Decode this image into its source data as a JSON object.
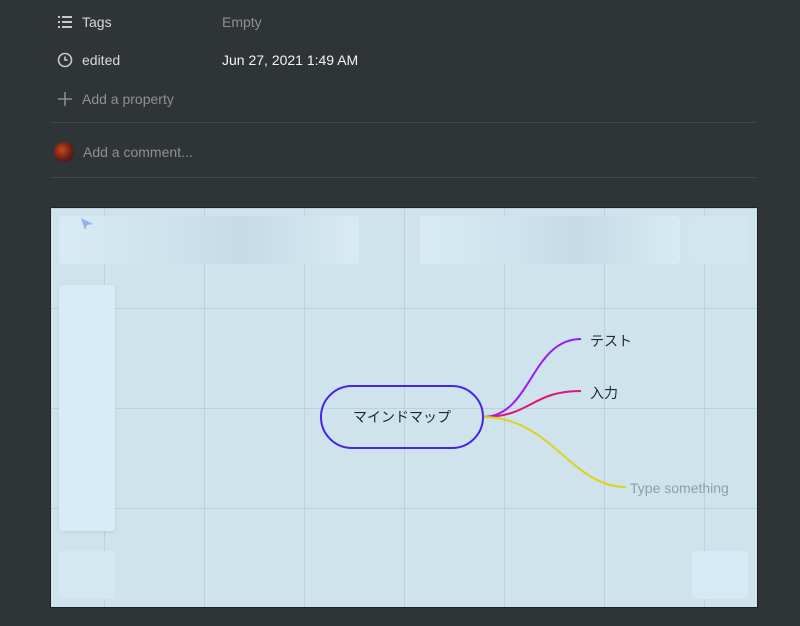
{
  "properties": [
    {
      "icon": "list-icon",
      "name": "Tags",
      "value": "Empty",
      "value_style": "muted"
    },
    {
      "icon": "clock-icon",
      "name": "edited",
      "value": "Jun 27, 2021 1:49 AM",
      "value_style": "strong"
    }
  ],
  "add_property": {
    "label": "Add a property",
    "icon": "plus-icon"
  },
  "comment": {
    "placeholder": "Add a comment..."
  },
  "mindmap": {
    "center": "マインドマップ",
    "branches": [
      {
        "label": "テスト",
        "color": "#9b1cf0",
        "placeholder": false
      },
      {
        "label": "入力",
        "color": "#e0157a",
        "placeholder": false
      },
      {
        "label": "Type something",
        "color": "#d9d41a",
        "placeholder": true
      }
    ],
    "center_border_color": "#4a22e6"
  },
  "colors": {
    "page_bg": "#2f3437",
    "canvas_bg": "#cfe3ec"
  }
}
